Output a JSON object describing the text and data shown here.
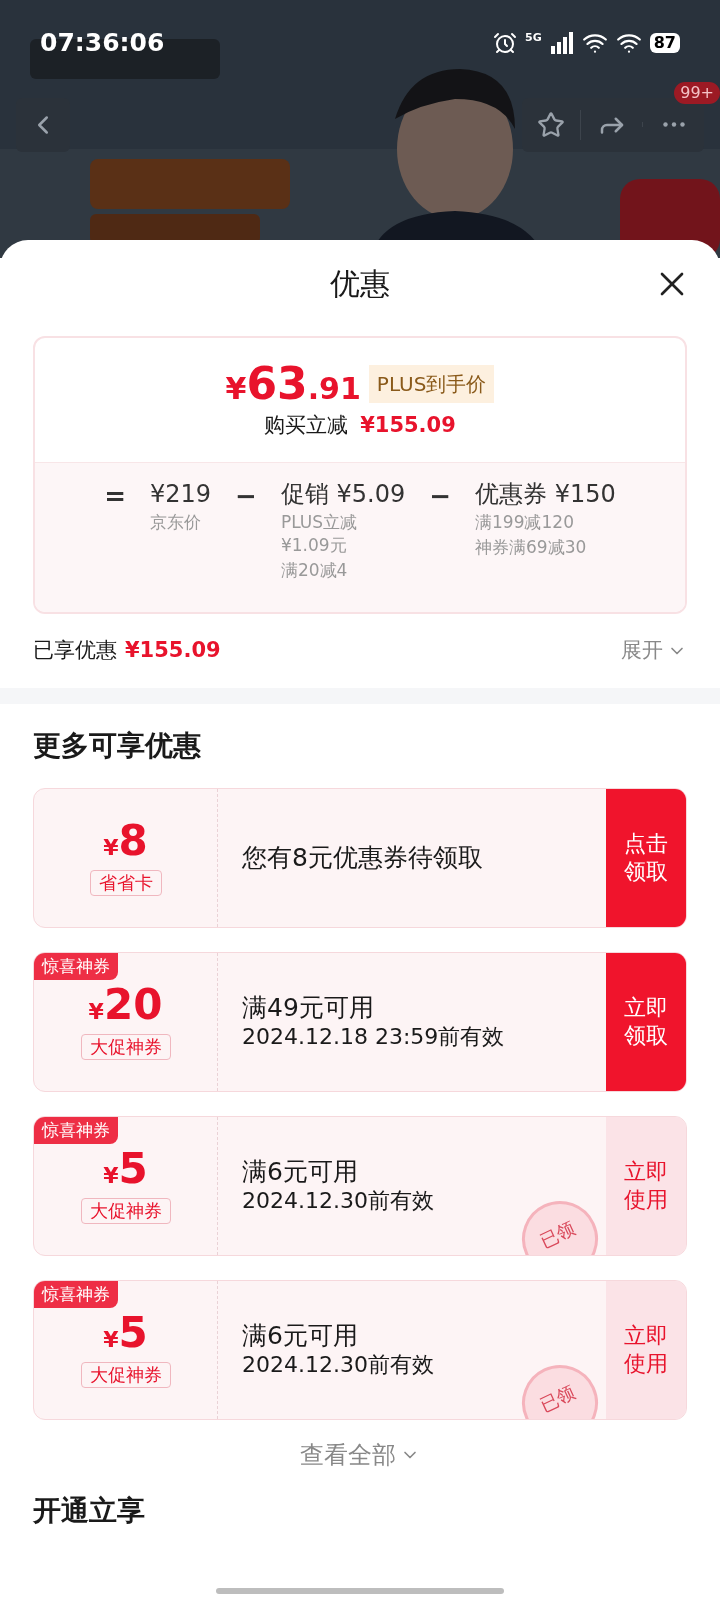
{
  "status_bar": {
    "time": "07:36:06",
    "network": "5G",
    "battery": "87"
  },
  "top_actions": {
    "badge": "99+"
  },
  "sheet": {
    "title": "优惠",
    "summary": {
      "price": {
        "currency": "¥",
        "integer": "63",
        "decimal": ".91"
      },
      "price_tag": "PLUS到手价",
      "saving_label": "购买立减",
      "saving_value": "¥155.09",
      "formula": [
        {
          "kind": "operator",
          "symbol": "="
        },
        {
          "kind": "term",
          "value": "¥219",
          "notes": [
            "京东价"
          ]
        },
        {
          "kind": "operator",
          "symbol": "−"
        },
        {
          "kind": "term",
          "value": "促销 ¥5.09",
          "notes": [
            "PLUS立减\n¥1.09元",
            "满20减4"
          ]
        },
        {
          "kind": "operator",
          "symbol": "−"
        },
        {
          "kind": "term",
          "value": "优惠券 ¥150",
          "notes": [
            "满199减120",
            "神券满69减30"
          ]
        }
      ]
    },
    "enjoyed_label": "已享优惠",
    "enjoyed_value": "¥155.09",
    "expand": "展开"
  },
  "more": {
    "title": "更多可享优惠",
    "coupons": [
      {
        "currency": "¥",
        "amount": "8",
        "badge": "省省卡",
        "lines": [
          "您有8元优惠券待领取"
        ],
        "action": {
          "kind": "claim",
          "label": [
            "点击",
            "领取"
          ]
        }
      },
      {
        "tag": "惊喜神券",
        "currency": "¥",
        "amount": "20",
        "badge": "大促神券",
        "lines": [
          "满49元可用",
          "2024.12.18 23:59前有效"
        ],
        "action": {
          "kind": "claim",
          "label": [
            "立即",
            "领取"
          ]
        }
      },
      {
        "tag": "惊喜神券",
        "currency": "¥",
        "amount": "5",
        "badge": "大促神券",
        "lines": [
          "满6元可用",
          "2024.12.30前有效"
        ],
        "action": {
          "kind": "use",
          "label": [
            "立即",
            "使用"
          ]
        },
        "stamp": "已领"
      },
      {
        "tag": "惊喜神券",
        "currency": "¥",
        "amount": "5",
        "badge": "大促神券",
        "lines": [
          "满6元可用",
          "2024.12.30前有效"
        ],
        "action": {
          "kind": "use",
          "label": [
            "立即",
            "使用"
          ]
        },
        "stamp": "已领"
      }
    ],
    "view_all": "查看全部"
  },
  "next_section": {
    "title": "开通立享"
  }
}
